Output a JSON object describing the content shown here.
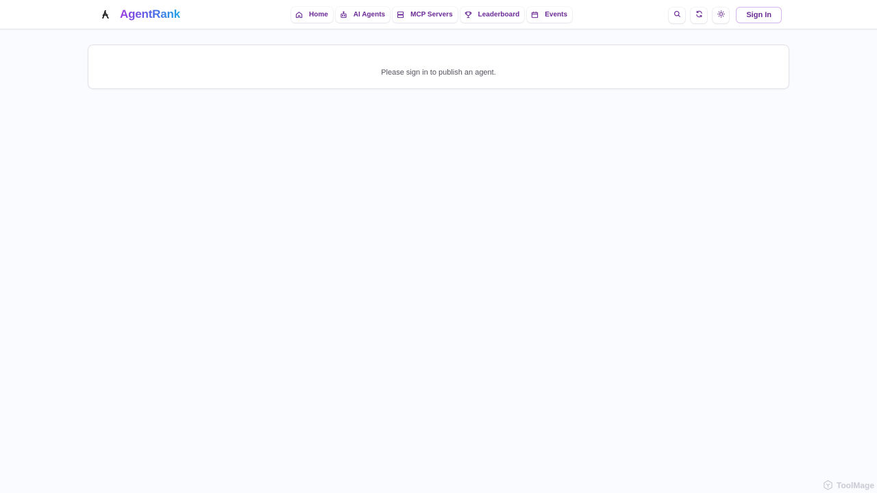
{
  "header": {
    "brand_name": "AgentRank",
    "brand_gradient": [
      "#9b3ae0",
      "#4f68e6",
      "#1fa7e8"
    ],
    "nav": [
      {
        "label": "Home",
        "icon": "home-icon"
      },
      {
        "label": "AI Agents",
        "icon": "robot-icon"
      },
      {
        "label": "MCP Servers",
        "icon": "server-icon"
      },
      {
        "label": "Leaderboard",
        "icon": "trophy-icon"
      },
      {
        "label": "Events",
        "icon": "calendar-icon"
      }
    ],
    "tools": [
      {
        "icon": "search-icon"
      },
      {
        "icon": "refresh-icon"
      },
      {
        "icon": "sun-icon"
      }
    ],
    "sign_in_label": "Sign In",
    "accent_color": "#6a2a96"
  },
  "main": {
    "message": "Please sign in to publish an agent."
  },
  "watermark": {
    "text": "ToolMage"
  }
}
